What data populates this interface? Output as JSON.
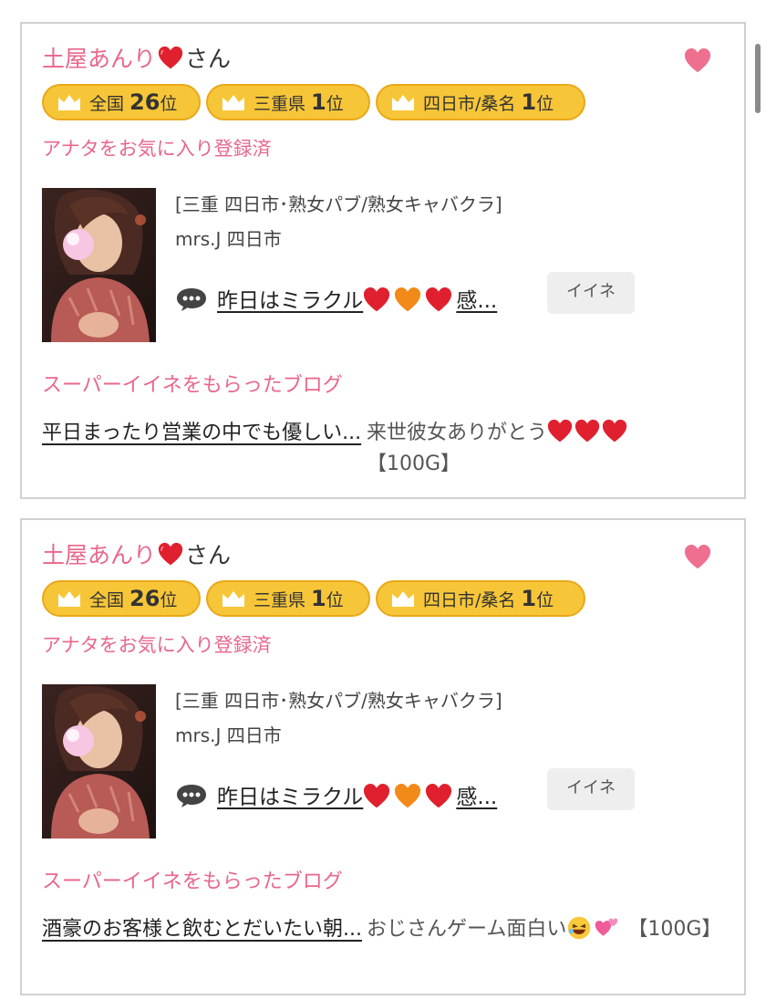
{
  "cards": [
    {
      "name": "土屋あんり",
      "name_suffix": "さん",
      "badges": [
        {
          "area": "全国",
          "rank": "26",
          "unit": "位"
        },
        {
          "area": "三重県",
          "rank": "1",
          "unit": "位"
        },
        {
          "area": "四日市/桑名",
          "rank": "1",
          "unit": "位"
        }
      ],
      "favorite_status": "アナタをお気に入り登録済",
      "shop_genre": "[三重 四日市･熟女パブ/熟女キャバクラ]",
      "shop_name": "mrs.J 四日市",
      "comment_start": "昨日はミラクル",
      "comment_end": "感...",
      "iine_label": "イイネ",
      "super_iine_label": "スーパーイイネをもらったブログ",
      "blog_title": "平日まったり営業の中でも優しい...",
      "blog_comment_text": "来世彼女ありがとう",
      "blog_comment_points": "【100G】"
    },
    {
      "name": "土屋あんり",
      "name_suffix": "さん",
      "badges": [
        {
          "area": "全国",
          "rank": "26",
          "unit": "位"
        },
        {
          "area": "三重県",
          "rank": "1",
          "unit": "位"
        },
        {
          "area": "四日市/桑名",
          "rank": "1",
          "unit": "位"
        }
      ],
      "favorite_status": "アナタをお気に入り登録済",
      "shop_genre": "[三重 四日市･熟女パブ/熟女キャバクラ]",
      "shop_name": "mrs.J 四日市",
      "comment_start": "昨日はミラクル",
      "comment_end": "感...",
      "iine_label": "イイネ",
      "super_iine_label": "スーパーイイネをもらったブログ",
      "blog_title": "酒豪のお客様と飲むとだいたい朝...",
      "blog_comment_text": "おじさんゲーム面白い",
      "blog_comment_points": "【100G】"
    }
  ],
  "colors": {
    "pink_accent": "#e9678b",
    "badge_gold": "#f7c638",
    "badge_border": "#e9a818",
    "card_border": "#d0d0d0"
  },
  "icons": [
    "heart-icon",
    "crown-icon",
    "chat-bubble-icon",
    "red-heart-emoji",
    "orange-heart-emoji",
    "laughing-emoji",
    "two-hearts-emoji"
  ]
}
